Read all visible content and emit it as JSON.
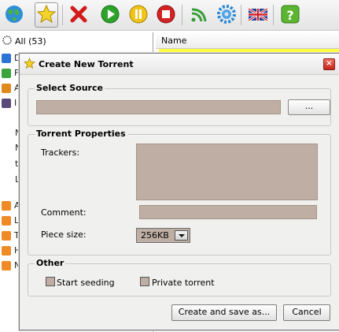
{
  "sidebar": {
    "all_label": "All (53)",
    "item_letters": [
      "D",
      "F",
      "A",
      "I"
    ],
    "lower_letters": [
      "N",
      "N",
      "t",
      "L"
    ],
    "feed_letters": [
      "A",
      "L",
      "T",
      "H",
      "N"
    ]
  },
  "list": {
    "column_name": "Name"
  },
  "dialog": {
    "title": "Create New Torrent",
    "close_glyph": "×",
    "select_source": {
      "heading": "Select Source",
      "path_value": "",
      "browse_label": "..."
    },
    "properties": {
      "heading": "Torrent Properties",
      "trackers_label": "Trackers:",
      "trackers_value": "",
      "comment_label": "Comment:",
      "comment_value": "",
      "piece_size_label": "Piece size:",
      "piece_size_value": "256KB"
    },
    "other": {
      "heading": "Other",
      "start_seeding_label": "Start seeding",
      "start_seeding_checked": false,
      "private_label": "Private torrent",
      "private_checked": false
    },
    "create_button": "Create and save as...",
    "cancel_button": "Cancel"
  },
  "toolbar_icons": [
    "globe-icon",
    "star-icon",
    "delete-icon",
    "start-icon",
    "pause-icon",
    "stop-icon",
    "rss-icon",
    "settings-icon",
    "uk-flag-icon",
    "help-icon"
  ],
  "colors": {
    "field_fill": "#bfaea4",
    "highlight_row": "#ffff44"
  }
}
